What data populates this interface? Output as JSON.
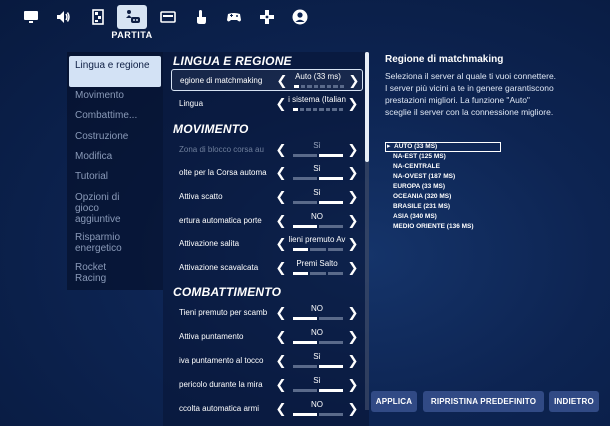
{
  "topbar": {
    "tabs": [
      {
        "icon": "monitor-icon"
      },
      {
        "icon": "speaker-icon"
      },
      {
        "icon": "controls-icon"
      },
      {
        "icon": "controller-person-icon",
        "active": true,
        "label": "PARTITA"
      },
      {
        "icon": "keyboard-icon"
      },
      {
        "icon": "touch-icon"
      },
      {
        "icon": "gamepad-icon"
      },
      {
        "icon": "dpad-icon"
      },
      {
        "icon": "account-icon"
      }
    ],
    "active_label": "PARTITA"
  },
  "sidebar": {
    "items": [
      {
        "label": "Lingua e regione",
        "active": true
      },
      {
        "label": "Movimento"
      },
      {
        "label": "Combattime..."
      },
      {
        "label": "Costruzione"
      },
      {
        "label": "Modifica"
      },
      {
        "label": "Tutorial"
      },
      {
        "label": "Opzioni di gioco aggiuntive"
      },
      {
        "label": "Risparmio energetico"
      },
      {
        "label": "Rocket Racing"
      }
    ]
  },
  "sections": {
    "lingua": {
      "title": "LINGUA E REGIONE",
      "rows": [
        {
          "label": "egione di matchmaking",
          "value": "Auto (33 ms)"
        },
        {
          "label": "Lingua",
          "value": "i sistema (Italian"
        }
      ]
    },
    "movimento": {
      "title": "MOVIMENTO",
      "rows": [
        {
          "label": "Zona di blocco corsa au",
          "value": "Sì"
        },
        {
          "label": "olte per la Corsa automa",
          "value": "Sì"
        },
        {
          "label": "Attiva scatto",
          "value": "Sì"
        },
        {
          "label": "ertura automatica porte",
          "value": "NO"
        },
        {
          "label": "Attivazione salita",
          "value": "lieni premuto Av"
        },
        {
          "label": "Attivazione scavalcata",
          "value": "Premi Salto"
        }
      ]
    },
    "combattimento": {
      "title": "COMBATTIMENTO",
      "rows": [
        {
          "label": "Tieni premuto per scamb",
          "value": "NO"
        },
        {
          "label": "Attiva puntamento",
          "value": "NO"
        },
        {
          "label": "iva puntamento al tocco",
          "value": "Sì"
        },
        {
          "label": "pericolo durante la mira",
          "value": "Sì"
        },
        {
          "label": "ccolta automatica armi",
          "value": "NO"
        }
      ]
    }
  },
  "description": {
    "title": "Regione di matchmaking",
    "text": "Seleziona il server al quale ti vuoi connettere. I server più vicini a te in genere garantiscono prestazioni migliori. La funzione \"Auto\" sceglie il server con la connessione migliore.",
    "options": [
      {
        "label": "AUTO (33 MS)",
        "selected": true
      },
      {
        "label": "NA-EST (125 MS)"
      },
      {
        "label": "NA-CENTRALE"
      },
      {
        "label": "NA-OVEST (187 MS)"
      },
      {
        "label": "EUROPA (33 MS)"
      },
      {
        "label": "OCEANIA (320 MS)"
      },
      {
        "label": "BRASILE (231 MS)"
      },
      {
        "label": "ASIA (340 MS)"
      },
      {
        "label": "MEDIO ORIENTE (136 MS)"
      }
    ]
  },
  "buttons": {
    "apply": "APPLICA",
    "reset": "RIPRISTINA PREDEFINITO",
    "back": "INDIETRO"
  }
}
